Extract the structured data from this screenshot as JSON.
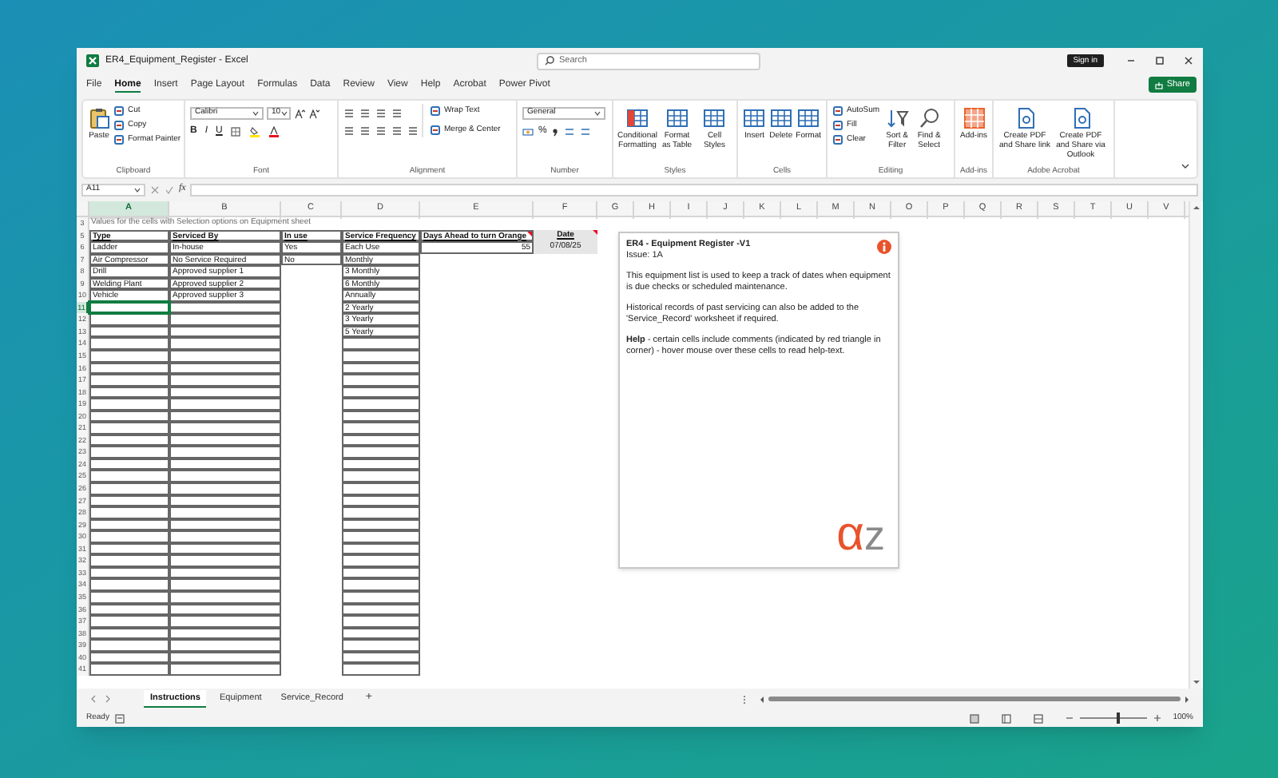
{
  "window": {
    "title": "ER4_Equipment_Register - Excel",
    "search_placeholder": "Search",
    "sign_in": "Sign in"
  },
  "menu_tabs": [
    {
      "label": "File",
      "selected": false
    },
    {
      "label": "Home",
      "selected": true
    },
    {
      "label": "Insert",
      "selected": false
    },
    {
      "label": "Page Layout",
      "selected": false
    },
    {
      "label": "Formulas",
      "selected": false
    },
    {
      "label": "Data",
      "selected": false
    },
    {
      "label": "Review",
      "selected": false
    },
    {
      "label": "View",
      "selected": false
    },
    {
      "label": "Help",
      "selected": false
    },
    {
      "label": "Acrobat",
      "selected": false
    },
    {
      "label": "Power Pivot",
      "selected": false
    }
  ],
  "share_button": "Share",
  "ribbon": [
    {
      "kind": "clipboard",
      "label": "Clipboard",
      "large": [
        "Paste"
      ],
      "small": [
        "Cut",
        "Copy",
        "Format Painter"
      ]
    },
    {
      "kind": "font",
      "label": "Font",
      "selects": [
        "Calibri",
        "10"
      ],
      "glyphs": [
        "B",
        "I",
        "U"
      ]
    },
    {
      "kind": "alignment",
      "label": "Alignment",
      "small": [
        "Wrap Text",
        "Merge & Center"
      ]
    },
    {
      "kind": "number",
      "label": "Number",
      "selects": [
        "General"
      ],
      "glyphs": [
        "%"
      ]
    },
    {
      "kind": "styles",
      "label": "Styles",
      "large": [
        "Conditional Formatting",
        "Format as Table",
        "Cell Styles"
      ]
    },
    {
      "kind": "cells",
      "label": "Cells",
      "large": [
        "Insert",
        "Delete",
        "Format"
      ]
    },
    {
      "kind": "editing",
      "label": "Editing",
      "small": [
        "AutoSum",
        "Fill",
        "Clear"
      ],
      "large": [
        "Sort & Filter",
        "Find & Select"
      ]
    },
    {
      "kind": "addins",
      "label": "Add-ins",
      "large": [
        "Add-ins"
      ]
    },
    {
      "kind": "acrobat",
      "label": "Adobe Acrobat",
      "large": [
        "Create PDF and Share link",
        "Create PDF and Share via Outlook"
      ]
    }
  ],
  "formula_bar": {
    "name_box": "A11",
    "fx": "fx"
  },
  "sheet": {
    "columns": [
      {
        "label": "A",
        "selected": true
      },
      {
        "label": "B",
        "selected": false
      },
      {
        "label": "C",
        "selected": false
      },
      {
        "label": "D",
        "selected": false
      },
      {
        "label": "E",
        "selected": false
      },
      {
        "label": "F",
        "selected": false
      },
      {
        "label": "G",
        "selected": false
      },
      {
        "label": "H",
        "selected": false
      },
      {
        "label": "I",
        "selected": false
      },
      {
        "label": "J",
        "selected": false
      },
      {
        "label": "K",
        "selected": false
      },
      {
        "label": "L",
        "selected": false
      },
      {
        "label": "M",
        "selected": false
      },
      {
        "label": "N",
        "selected": false
      },
      {
        "label": "O",
        "selected": false
      },
      {
        "label": "P",
        "selected": false
      },
      {
        "label": "Q",
        "selected": false
      },
      {
        "label": "R",
        "selected": false
      },
      {
        "label": "S",
        "selected": false
      },
      {
        "label": "T",
        "selected": false
      },
      {
        "label": "U",
        "selected": false
      },
      {
        "label": "V",
        "selected": false
      }
    ],
    "rows": [
      {
        "number": "3",
        "selected": false,
        "kind": "note",
        "cells": {
          "A": {
            "text": "Values for the cells with Selection options on Equipment sheet"
          }
        }
      },
      {
        "number": "5",
        "selected": false,
        "kind": "header",
        "cells": {
          "A": {
            "text": "Type"
          },
          "B": {
            "text": "Serviced By"
          },
          "C": {
            "text": "In use"
          },
          "D": {
            "text": "Service Frequency"
          },
          "E": {
            "text": "Days Ahead to turn Orange",
            "comment": true
          },
          "F": {
            "text": "Date",
            "comment": true,
            "shaded": true
          }
        }
      },
      {
        "number": "6",
        "selected": false,
        "cells": {
          "A": {
            "text": "Ladder"
          },
          "B": {
            "text": "In-house"
          },
          "C": {
            "text": "Yes"
          },
          "D": {
            "text": "Each Use"
          },
          "E": {
            "text": "55"
          },
          "F": {
            "text": "07/08/25",
            "shaded": true
          }
        }
      },
      {
        "number": "7",
        "selected": false,
        "cells": {
          "A": {
            "text": "Air Compressor"
          },
          "B": {
            "text": "No Service Required"
          },
          "C": {
            "text": "No"
          },
          "D": {
            "text": "Monthly"
          }
        }
      },
      {
        "number": "8",
        "selected": false,
        "cells": {
          "A": {
            "text": "Drill"
          },
          "B": {
            "text": "Approved supplier 1"
          },
          "D": {
            "text": "3 Monthly"
          }
        }
      },
      {
        "number": "9",
        "selected": false,
        "cells": {
          "A": {
            "text": "Welding Plant"
          },
          "B": {
            "text": "Approved supplier 2"
          },
          "D": {
            "text": "6 Monthly"
          }
        }
      },
      {
        "number": "10",
        "selected": false,
        "cells": {
          "A": {
            "text": "Vehicle"
          },
          "B": {
            "text": "Approved supplier 3"
          },
          "D": {
            "text": "Annually"
          }
        }
      },
      {
        "number": "11",
        "selected": true,
        "cells": {
          "D": {
            "text": "2 Yearly"
          }
        }
      },
      {
        "number": "12",
        "selected": false,
        "cells": {
          "D": {
            "text": "3 Yearly"
          }
        }
      },
      {
        "number": "13",
        "selected": false,
        "cells": {
          "D": {
            "text": "5 Yearly"
          }
        }
      },
      {
        "number": "14",
        "selected": false,
        "cells": {}
      },
      {
        "number": "15",
        "selected": false,
        "cells": {}
      },
      {
        "number": "16",
        "selected": false,
        "cells": {}
      },
      {
        "number": "17",
        "selected": false,
        "cells": {}
      },
      {
        "number": "18",
        "selected": false,
        "cells": {}
      },
      {
        "number": "19",
        "selected": false,
        "cells": {}
      },
      {
        "number": "20",
        "selected": false,
        "cells": {}
      },
      {
        "number": "21",
        "selected": false,
        "cells": {}
      },
      {
        "number": "22",
        "selected": false,
        "cells": {}
      },
      {
        "number": "23",
        "selected": false,
        "cells": {}
      },
      {
        "number": "24",
        "selected": false,
        "cells": {}
      },
      {
        "number": "25",
        "selected": false,
        "cells": {}
      },
      {
        "number": "26",
        "selected": false,
        "cells": {}
      },
      {
        "number": "27",
        "selected": false,
        "cells": {}
      },
      {
        "number": "28",
        "selected": false,
        "cells": {}
      },
      {
        "number": "29",
        "selected": false,
        "cells": {}
      },
      {
        "number": "30",
        "selected": false,
        "cells": {}
      },
      {
        "number": "31",
        "selected": false,
        "cells": {}
      },
      {
        "number": "32",
        "selected": false,
        "cells": {}
      },
      {
        "number": "33",
        "selected": false,
        "cells": {}
      },
      {
        "number": "34",
        "selected": false,
        "cells": {}
      },
      {
        "number": "35",
        "selected": false,
        "cells": {}
      },
      {
        "number": "36",
        "selected": false,
        "cells": {}
      },
      {
        "number": "37",
        "selected": false,
        "cells": {}
      },
      {
        "number": "38",
        "selected": false,
        "cells": {}
      },
      {
        "number": "39",
        "selected": false,
        "cells": {}
      },
      {
        "number": "40",
        "selected": false,
        "cells": {}
      },
      {
        "number": "41",
        "selected": false,
        "cells": {}
      }
    ]
  },
  "info_box": {
    "title": "ER4 - Equipment Register -V1",
    "issue": "Issue: 1A",
    "paragraphs": [
      "This equipment list is used to keep a track of dates when equipment is due checks or scheduled maintenance.",
      "Historical records of past servicing can also be added to the 'Service_Record' worksheet if required.",
      "**Help** - certain cells include comments (indicated by red triangle in corner) - hover mouse over these cells to read help-text."
    ],
    "logo": [
      "α",
      "z"
    ]
  },
  "sheet_tabs": [
    {
      "label": "Instructions",
      "selected": true
    },
    {
      "label": "Equipment",
      "selected": false
    },
    {
      "label": "Service_Record",
      "selected": false
    }
  ],
  "add_sheet": "+",
  "status_bar": {
    "status": "Ready",
    "zoom": {
      "label": "100%",
      "level": 0.55
    }
  }
}
